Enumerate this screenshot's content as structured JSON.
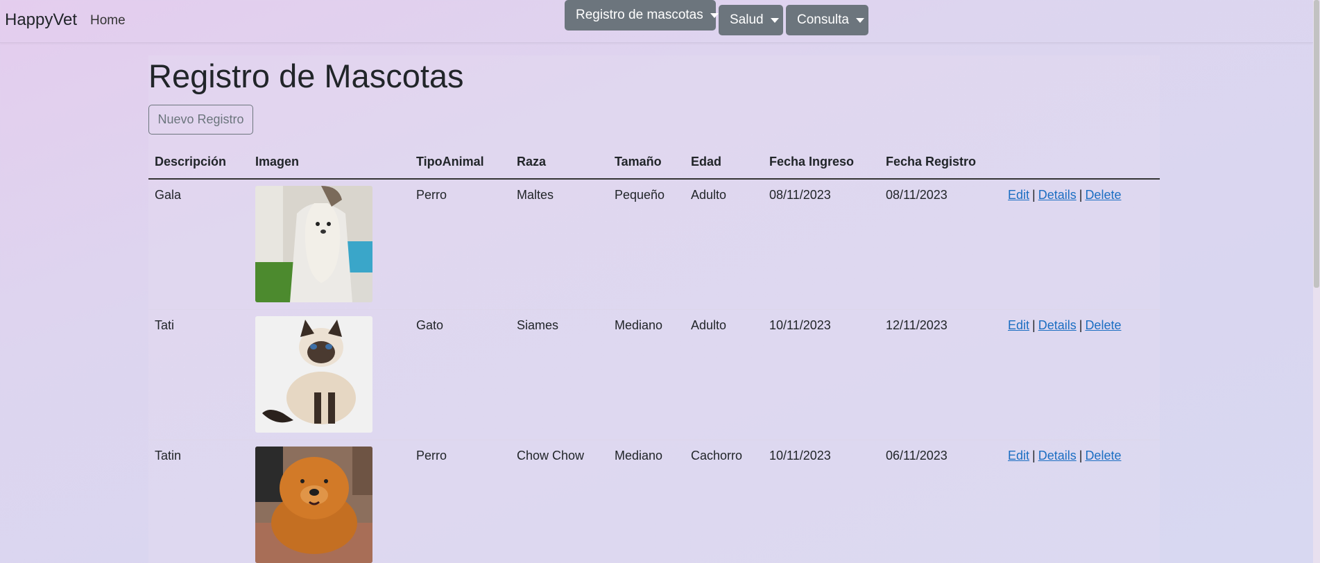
{
  "navbar": {
    "brand": "HappyVet",
    "home": "Home",
    "dropdowns": [
      {
        "label": "Registro de mascotas"
      },
      {
        "label": "Salud"
      },
      {
        "label": "Consulta"
      }
    ]
  },
  "page": {
    "title": "Registro de Mascotas",
    "new_button": "Nuevo Registro"
  },
  "table": {
    "headers": [
      "Descripción",
      "Imagen",
      "TipoAnimal",
      "Raza",
      "Tamaño",
      "Edad",
      "Fecha Ingreso",
      "Fecha Registro",
      ""
    ],
    "rows": [
      {
        "descripcion": "Gala",
        "image": "photo-maltese-dog",
        "tipo": "Perro",
        "raza": "Maltes",
        "tamano": "Pequeño",
        "edad": "Adulto",
        "ingreso": "08/11/2023",
        "registro": "08/11/2023"
      },
      {
        "descripcion": "Tati",
        "image": "photo-siamese-cat",
        "tipo": "Gato",
        "raza": "Siames",
        "tamano": "Mediano",
        "edad": "Adulto",
        "ingreso": "10/11/2023",
        "registro": "12/11/2023"
      },
      {
        "descripcion": "Tatin",
        "image": "photo-chow-chow-dog",
        "tipo": "Perro",
        "raza": "Chow Chow",
        "tamano": "Mediano",
        "edad": "Cachorro",
        "ingreso": "10/11/2023",
        "registro": "06/11/2023"
      }
    ],
    "actions": {
      "edit": "Edit",
      "details": "Details",
      "delete": "Delete",
      "separator": "|"
    }
  }
}
